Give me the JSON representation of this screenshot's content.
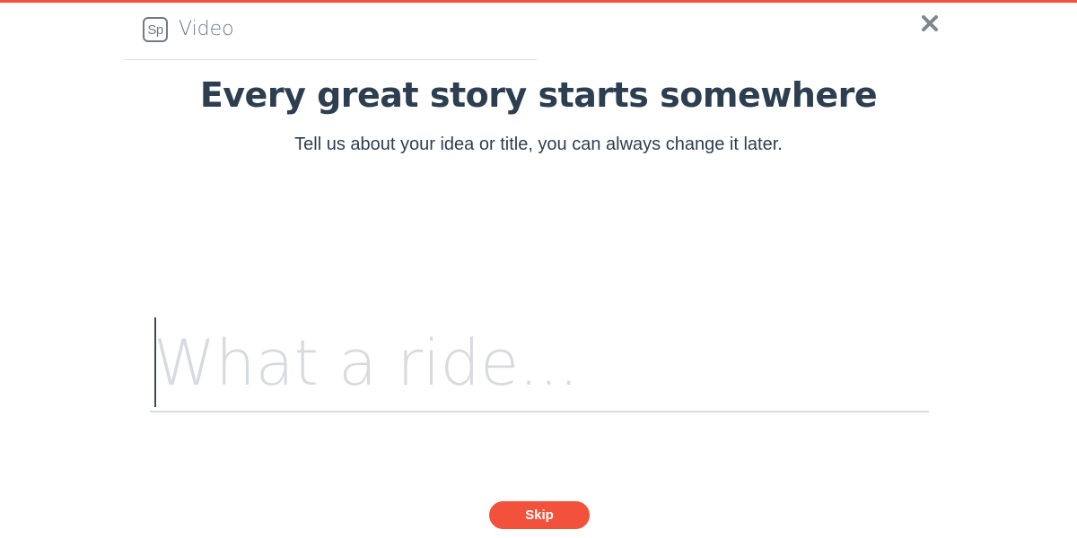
{
  "header": {
    "logo_text": "Sp",
    "app_name": "Video"
  },
  "close_icon": "close-icon",
  "headline": "Every great story starts somewhere",
  "subhead": "Tell us about your idea or title, you can always change it later.",
  "title_input": {
    "value": "",
    "placeholder": "What a ride..."
  },
  "skip_label": "Skip",
  "colors": {
    "accent": "#f2523b",
    "heading": "#2c3e50",
    "muted": "#6f7b89",
    "placeholder": "#d7dade"
  }
}
